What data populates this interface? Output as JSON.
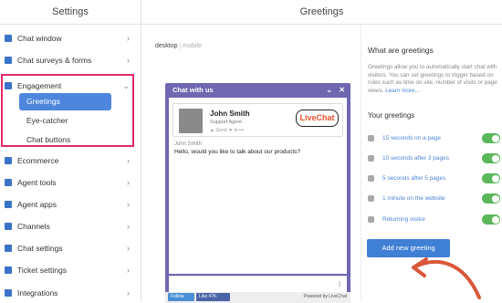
{
  "header": {
    "left_title": "Settings",
    "right_title": "Greetings"
  },
  "sidebar": {
    "items": [
      {
        "label": "Chat window",
        "icon": "chat-window-icon"
      },
      {
        "label": "Chat surveys & forms",
        "icon": "survey-icon"
      },
      {
        "label": "Engagement",
        "icon": "eye-icon"
      },
      {
        "label": "Ecommerce",
        "icon": "cart-icon"
      },
      {
        "label": "Agent tools",
        "icon": "wrench-icon"
      },
      {
        "label": "Agent apps",
        "icon": "apps-icon"
      },
      {
        "label": "Channels",
        "icon": "channels-icon"
      },
      {
        "label": "Chat settings",
        "icon": "chat-settings-icon"
      },
      {
        "label": "Ticket settings",
        "icon": "ticket-icon"
      },
      {
        "label": "Integrations",
        "icon": "integrations-icon"
      }
    ],
    "engagement_sub": [
      "Greetings",
      "Eye-catcher",
      "Chat buttons"
    ],
    "highlight_color": "#e0286e",
    "active_color": "#4d86dc"
  },
  "preview": {
    "desktop_label": "desktop",
    "mobile_label": "mobile",
    "widget_title": "Chat with us",
    "agent_name": "John Smith",
    "agent_role": "Support Agent",
    "rating_label": "Good",
    "logo_text": "LiveChat",
    "msg_author": "John Smith",
    "msg_text": "Hello, would you like to talk about our products?",
    "follow_label": "Follow",
    "like_label": "Like 47K",
    "powered_by": "Powered by LiveChat",
    "widget_color": "#6f67b0"
  },
  "panel": {
    "title": "What are greetings",
    "description": "Greetings allow you to automatically start chat with visitors. You can set greetings to trigger based on rules such as time on site, number of visits or page views.",
    "learn_more": "Learn more...",
    "your_greetings": "Your greetings",
    "greetings": [
      {
        "label": "15 seconds on a page",
        "enabled": true
      },
      {
        "label": "10 seconds after 3 pages",
        "enabled": true
      },
      {
        "label": "5 seconds after 5 pages",
        "enabled": true
      },
      {
        "label": "1 minute on the website",
        "enabled": true
      },
      {
        "label": "Returning visitor",
        "enabled": true
      }
    ],
    "add_button": "Add new greeting",
    "toggle_color": "#5ab85a"
  }
}
